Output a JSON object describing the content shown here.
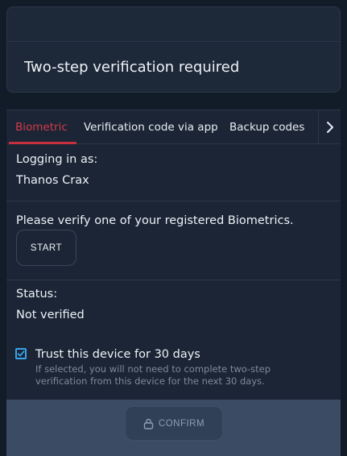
{
  "header": {
    "title": "Two-step verification required"
  },
  "tabs": {
    "items": [
      {
        "label": "Biometric",
        "active": true
      },
      {
        "label": "Verification code via app",
        "active": false
      },
      {
        "label": "Backup codes",
        "active": false
      }
    ],
    "more_icon": "chevron-right-icon"
  },
  "login": {
    "label": "Logging in as:",
    "user": "Thanos Crax"
  },
  "biometric": {
    "prompt": "Please verify one of your registered Biometrics.",
    "start_label": "START"
  },
  "status": {
    "label": "Status:",
    "value": "Not verified"
  },
  "trust": {
    "checked": true,
    "label": "Trust this device for 30 days",
    "help": "If selected, you will not need to complete two-step verification from this device for the next 30 days."
  },
  "footer": {
    "confirm_label": "CONFIRM",
    "confirm_icon": "lock-icon",
    "confirm_disabled": true
  },
  "colors": {
    "background": "#121b28",
    "panel": "#1b2535",
    "accent_red": "#c8303f",
    "checkbox_blue": "#3aa3e8",
    "footer": "#3b4b63"
  }
}
